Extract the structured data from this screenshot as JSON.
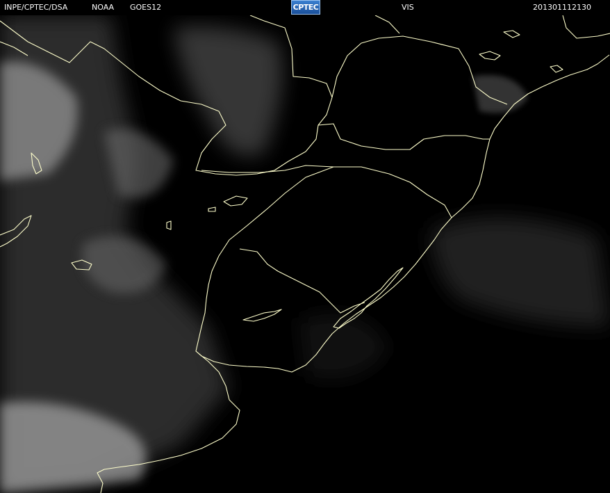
{
  "header": {
    "source": "INPE/CPTEC/DSA",
    "agency": "NOAA",
    "satellite": "GOES12",
    "logo_text": "CPTEC",
    "channel": "VIS",
    "timestamp": "201301112130"
  },
  "colors": {
    "background": "#000000",
    "coastline": "#ffffcc",
    "header_text": "#ffffff",
    "cloud": "#c8c8c8"
  }
}
